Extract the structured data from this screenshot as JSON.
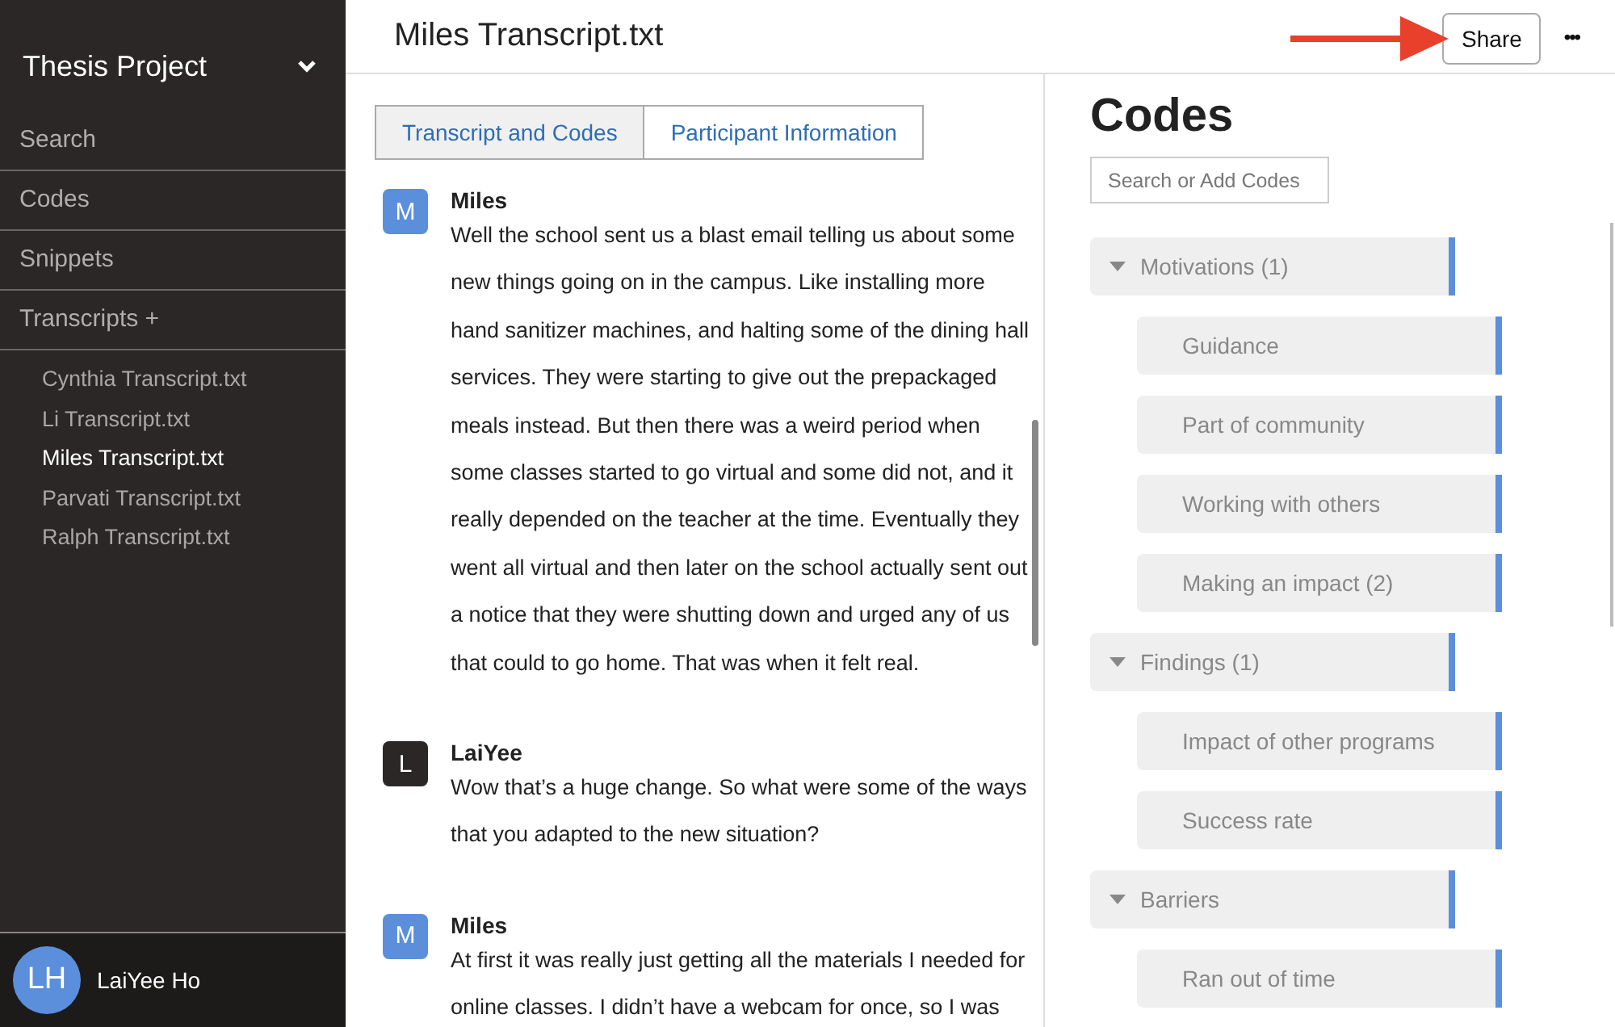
{
  "sidebar": {
    "project": "Thesis Project",
    "nav": [
      {
        "label": "Search"
      },
      {
        "label": "Codes"
      },
      {
        "label": "Snippets"
      },
      {
        "label": "Transcripts +"
      }
    ],
    "transcripts": [
      {
        "label": "Cynthia Transcript.txt",
        "selected": false
      },
      {
        "label": "Li Transcript.txt",
        "selected": false
      },
      {
        "label": "Miles Transcript.txt",
        "selected": true
      },
      {
        "label": "Parvati Transcript.txt",
        "selected": false
      },
      {
        "label": "Ralph Transcript.txt",
        "selected": false
      }
    ],
    "user": {
      "initials": "LH",
      "name": "LaiYee Ho"
    }
  },
  "header": {
    "title": "Miles Transcript.txt",
    "share": "Share",
    "more": "•••"
  },
  "tabs": [
    {
      "label": "Transcript and Codes",
      "selected": true
    },
    {
      "label": "Participant Information",
      "selected": false
    }
  ],
  "messages": [
    {
      "initial": "M",
      "color": "#5b8fdc",
      "speaker": "Miles",
      "text": "Well the school sent us a blast email telling us about some new things going on in the campus. Like installing more hand sanitizer machines, and halting some of the dining hall services. They were starting to give out the prepackaged meals instead. But then there was a weird period when some classes started to go virtual and some did not, and it really depended on the teacher at the time. Eventually they went all virtual and then later on the school actually sent out a notice that they were shutting down and urged any of us that could to go home. That was when it felt real."
    },
    {
      "initial": "L",
      "color": "#2b2727",
      "speaker": "LaiYee",
      "text": "Wow that’s a huge change. So what were some of the ways that you adapted to the new situation?"
    },
    {
      "initial": "M",
      "color": "#5b8fdc",
      "speaker": "Miles",
      "text": "At first it was really just getting all the materials I needed for online classes. I didn’t have a webcam for once, so I was"
    }
  ],
  "codes": {
    "title": "Codes",
    "search_placeholder": "Search or Add Codes",
    "tree": [
      {
        "label": "Motivations (1)",
        "expanded": true,
        "children": [
          {
            "label": "Guidance"
          },
          {
            "label": "Part of community"
          },
          {
            "label": "Working with others"
          },
          {
            "label": "Making an impact (2)"
          }
        ]
      },
      {
        "label": "Findings (1)",
        "expanded": true,
        "children": [
          {
            "label": "Impact of other programs"
          },
          {
            "label": "Success rate"
          }
        ]
      },
      {
        "label": "Barriers",
        "expanded": true,
        "children": [
          {
            "label": "Ran out of time"
          }
        ]
      }
    ]
  }
}
